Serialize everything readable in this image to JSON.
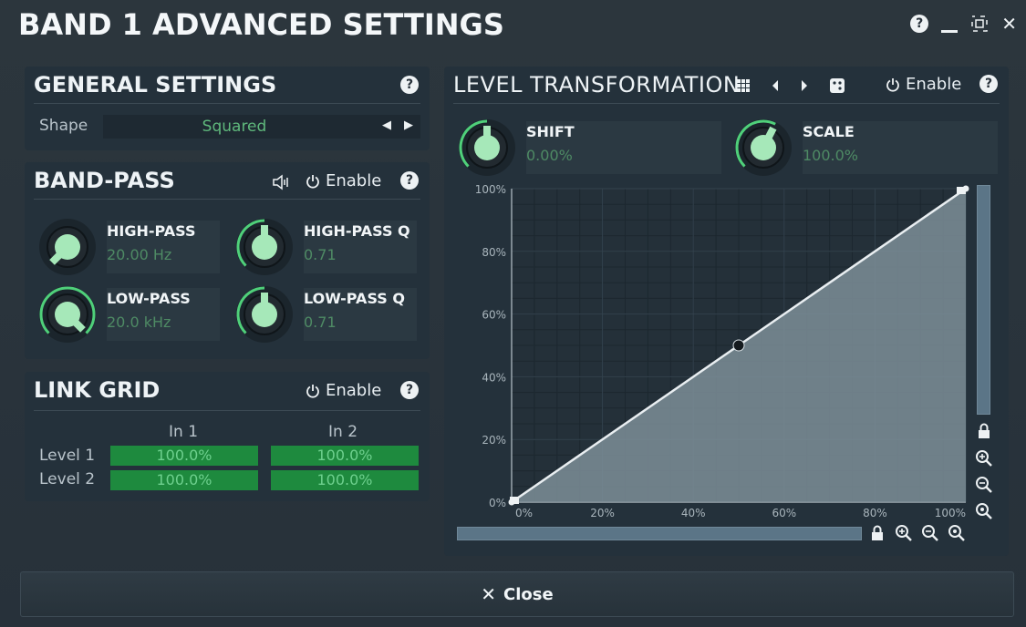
{
  "window": {
    "title": "BAND 1 ADVANCED SETTINGS",
    "help_glyph": "?",
    "minimize_icon": "minimize-icon",
    "maximize_icon": "maximize-icon",
    "close_glyph": "✕"
  },
  "general": {
    "title": "GENERAL SETTINGS",
    "help_glyph": "?",
    "shape_label": "Shape",
    "shape_value": "Squared",
    "prev_glyph": "◀",
    "next_glyph": "▶"
  },
  "bandpass": {
    "title": "BAND-PASS",
    "enable_label": "Enable",
    "help_glyph": "?",
    "knobs": [
      {
        "name": "HIGH-PASS",
        "value": "20.00 Hz",
        "level": 0.0
      },
      {
        "name": "HIGH-PASS Q",
        "value": "0.71",
        "level": 0.5
      },
      {
        "name": "LOW-PASS",
        "value": "20.0 kHz",
        "level": 1.0
      },
      {
        "name": "LOW-PASS Q",
        "value": "0.71",
        "level": 0.5
      }
    ]
  },
  "linkgrid": {
    "title": "LINK GRID",
    "enable_label": "Enable",
    "help_glyph": "?",
    "columns": [
      "In 1",
      "In 2"
    ],
    "rows": [
      {
        "label": "Level 1",
        "cells": [
          "100.0%",
          "100.0%"
        ]
      },
      {
        "label": "Level 2",
        "cells": [
          "100.0%",
          "100.0%"
        ]
      }
    ]
  },
  "level_transform": {
    "title": "LEVEL TRANSFORMATION",
    "enable_label": "Enable",
    "help_glyph": "?",
    "knobs": [
      {
        "name": "SHIFT",
        "value": "0.00%",
        "level": 0.5
      },
      {
        "name": "SCALE",
        "value": "100.0%",
        "level": 0.6
      }
    ],
    "x_ticks": [
      "0%",
      "20%",
      "40%",
      "60%",
      "80%",
      "100%"
    ],
    "y_ticks": [
      "0%",
      "20%",
      "40%",
      "60%",
      "80%",
      "100%"
    ]
  },
  "chart_data": {
    "type": "area",
    "x": [
      0,
      50,
      100
    ],
    "series": [
      {
        "values": [
          0,
          50,
          100
        ]
      }
    ],
    "xlim": [
      0,
      100
    ],
    "ylim": [
      0,
      100
    ],
    "x_tick_labels": [
      "0%",
      "20%",
      "40%",
      "60%",
      "80%",
      "100%"
    ],
    "y_tick_labels": [
      "0%",
      "20%",
      "40%",
      "60%",
      "80%",
      "100%"
    ],
    "grid": true,
    "control_points": [
      {
        "x": 0,
        "y": 0
      },
      {
        "x": 50,
        "y": 50
      },
      {
        "x": 100,
        "y": 100
      }
    ]
  },
  "footer": {
    "close_glyph": "✕",
    "close_label": "Close"
  },
  "colors": {
    "accent_green": "#4fd07a",
    "panel_bg": "#24313b",
    "value_green": "#4e8a64"
  }
}
